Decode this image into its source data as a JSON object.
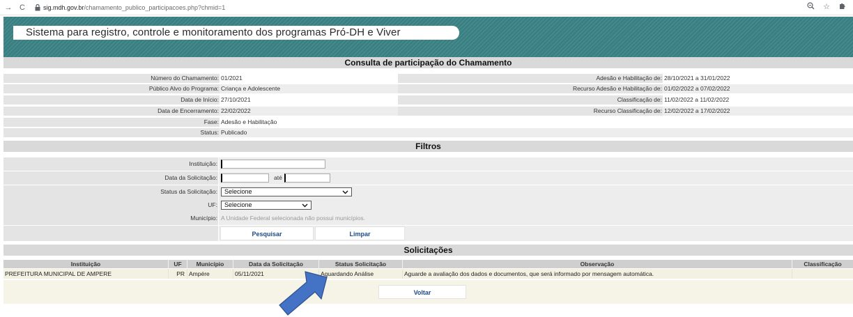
{
  "browser": {
    "url_host": "sig.mdh.gov.br",
    "url_path": "/chamamento_publico_participacoes.php?chmid=1"
  },
  "header": {
    "title": "Sistema para registro, controle e monitoramento dos programas Pró-DH e Viver"
  },
  "consulta": {
    "title": "Consulta de participação do Chamamento",
    "left": [
      {
        "label": "Número do Chamamento:",
        "value": "01/2021"
      },
      {
        "label": "Público Alvo do Programa:",
        "value": "Criança e Adolescente"
      },
      {
        "label": "Data de Início:",
        "value": "27/10/2021"
      },
      {
        "label": "Data de Encerramento:",
        "value": "22/02/2022"
      },
      {
        "label": "Fase:",
        "value": "Adesão e Habilitação"
      },
      {
        "label": "Status:",
        "value": "Publicado"
      }
    ],
    "right": [
      {
        "label": "Adesão e Habilitação de:",
        "value": "28/10/2021 a 31/01/2022"
      },
      {
        "label": "Recurso Adesão e Habilitação de:",
        "value": "01/02/2022 a 07/02/2022"
      },
      {
        "label": "Classificação de:",
        "value": "11/02/2022 a 11/02/2022"
      },
      {
        "label": "Recurso Classificação de:",
        "value": "12/02/2022 a 17/02/2022"
      }
    ]
  },
  "filtros": {
    "title": "Filtros",
    "instituicao_label": "Instituição:",
    "instituicao_value": "",
    "data_label": "Data da Solicitação:",
    "data_inicio": "",
    "ate_label": "até",
    "data_fim": "",
    "status_label": "Status da Solicitação:",
    "status_value": "Selecione",
    "uf_label": "UF:",
    "uf_value": "Selecione",
    "municipio_label": "Município:",
    "municipio_msg": "A Unidade Federal selecionada não possui municípios.",
    "pesquisar_label": "Pesquisar",
    "limpar_label": "Limpar"
  },
  "solicitacoes": {
    "title": "Solicitações",
    "columns": [
      "Instituição",
      "UF",
      "Município",
      "Data da Solicitação",
      "Status Solicitação",
      "Observação",
      "Classificação"
    ],
    "rows": [
      [
        "PREFEITURA MUNICIPAL DE AMPERE",
        "PR",
        "Ampére",
        "05/11/2021",
        "Aguardando Análise",
        "Aguarde a avaliação dos dados e documentos, que será informado por mensagem automática.",
        ""
      ]
    ],
    "voltar_label": "Voltar"
  },
  "colors": {
    "header_bg": "#3a8083",
    "link": "#1b4b8a",
    "arrow": "#4472c4"
  }
}
